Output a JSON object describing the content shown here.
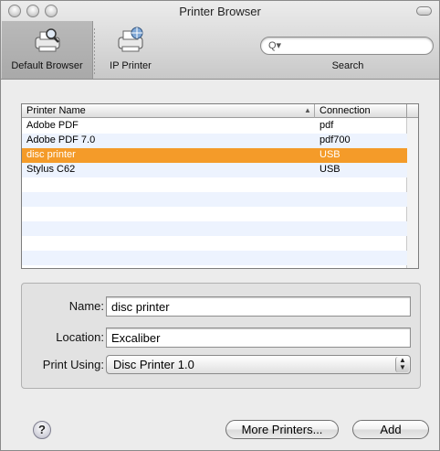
{
  "window": {
    "title": "Printer Browser"
  },
  "toolbar": {
    "default_browser": "Default Browser",
    "ip_printer": "IP Printer",
    "search_label": "Search",
    "search_value": ""
  },
  "table": {
    "col_name": "Printer Name",
    "col_connection": "Connection",
    "sort_indicator": "▲",
    "rows": [
      {
        "name": "Adobe PDF",
        "connection": "pdf"
      },
      {
        "name": "Adobe PDF 7.0",
        "connection": "pdf700"
      },
      {
        "name": "disc printer",
        "connection": "USB"
      },
      {
        "name": "Stylus C62",
        "connection": "USB"
      }
    ],
    "selected_index": 2
  },
  "details": {
    "name_label": "Name:",
    "name_value": "disc printer",
    "location_label": "Location:",
    "location_value": "Excaliber",
    "print_using_label": "Print Using:",
    "print_using_value": "Disc Printer 1.0"
  },
  "buttons": {
    "help": "?",
    "more_printers": "More Printers...",
    "add": "Add"
  },
  "colors": {
    "selection": "#f49b29"
  }
}
